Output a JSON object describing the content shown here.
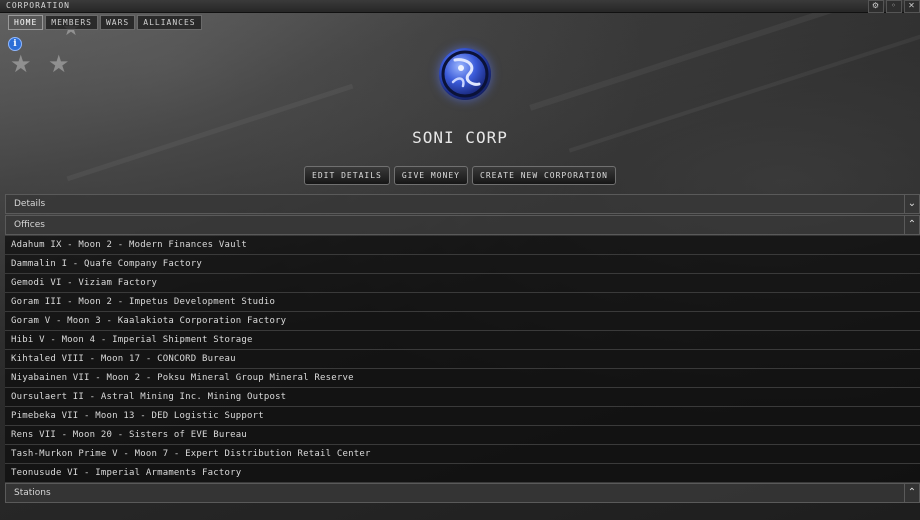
{
  "window": {
    "title": "CORPORATION",
    "buttons": [
      "settings-icon",
      "minimize-icon",
      "close-icon"
    ]
  },
  "tabs": [
    {
      "label": "HOME",
      "active": true
    },
    {
      "label": "MEMBERS",
      "active": false
    },
    {
      "label": "WARS",
      "active": false
    },
    {
      "label": "ALLIANCES",
      "active": false
    }
  ],
  "corporation": {
    "name": "SONI CORP"
  },
  "actions": {
    "edit": "EDIT DETAILS",
    "give_money": "GIVE MONEY",
    "create_new": "CREATE NEW CORPORATION"
  },
  "sections": {
    "details": "Details",
    "offices": "Offices",
    "stations": "Stations"
  },
  "offices": [
    "Adahum IX - Moon 2 - Modern Finances Vault",
    "Dammalin I - Quafe Company Factory",
    "Gemodi VI - Viziam Factory",
    "Goram III - Moon 2 - Impetus Development Studio",
    "Goram V - Moon 3 - Kaalakiota Corporation Factory",
    "Hibi V - Moon 4 - Imperial Shipment Storage",
    "Kihtaled VIII - Moon 17 - CONCORD Bureau",
    "Niyabainen VII - Moon 2 - Poksu Mineral Group Mineral Reserve",
    "Oursulaert II - Astral Mining Inc. Mining Outpost",
    "Pimebeka VII - Moon 13 - DED Logistic Support",
    "Rens VII - Moon 20 - Sisters of EVE Bureau",
    "Tash-Murkon Prime V - Moon 7 - Expert Distribution Retail Center",
    "Teonusude VI - Imperial Armaments Factory"
  ],
  "colors": {
    "accent": "#2d6fd6",
    "logo": "#3a5ad8"
  }
}
